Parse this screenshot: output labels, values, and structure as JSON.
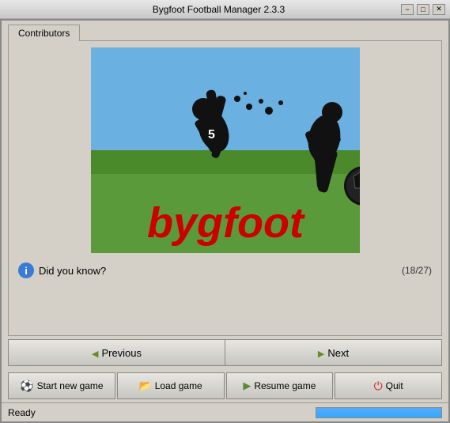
{
  "titlebar": {
    "title": "Bygfoot Football Manager 2.3.3",
    "minimize": "−",
    "maximize": "□",
    "close": "✕"
  },
  "tabs": [
    {
      "label": "Contributors"
    }
  ],
  "logo": {
    "alt": "Bygfoot Football Manager Logo"
  },
  "did_you_know": {
    "label": "Did you know?",
    "counter": "(18/27)"
  },
  "fact_text": "",
  "nav": {
    "previous": "Previous",
    "next": "Next"
  },
  "actions": {
    "start_new_game": "Start new game",
    "load_game": "Load game",
    "resume_game": "Resume game",
    "quit": "Quit"
  },
  "status": {
    "text": "Ready"
  }
}
